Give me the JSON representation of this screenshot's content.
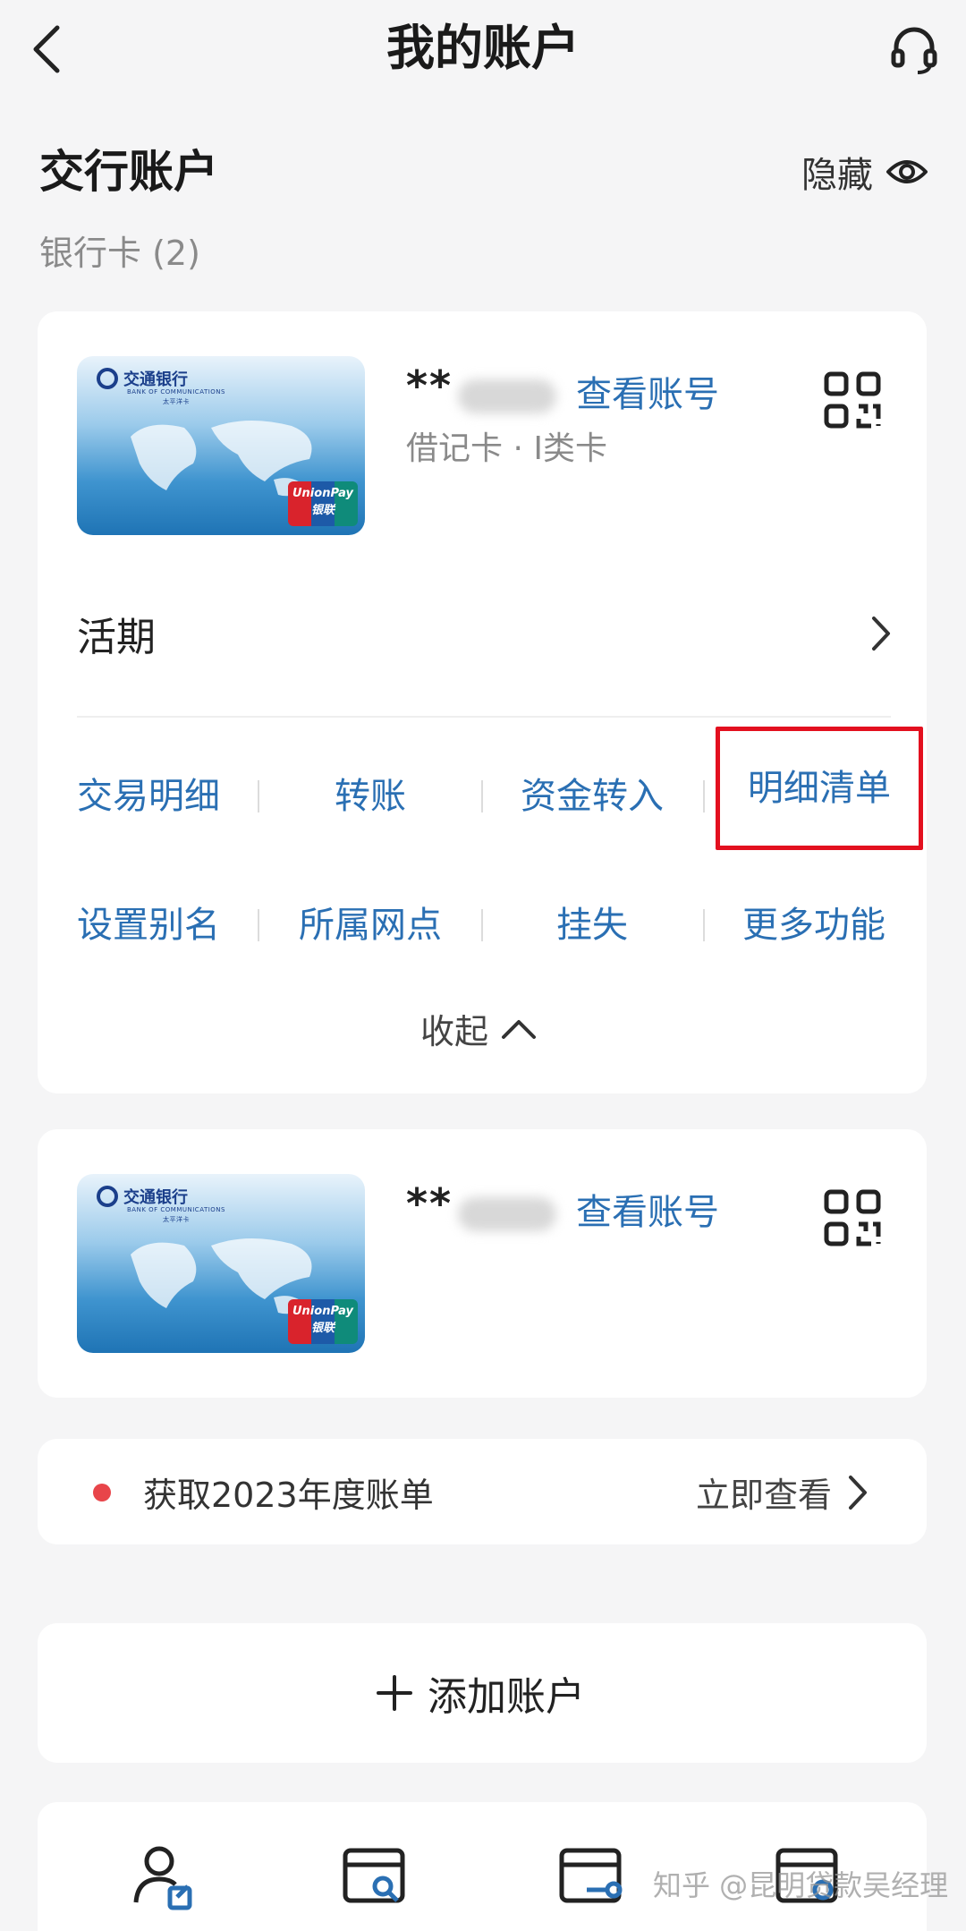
{
  "header": {
    "title": "我的账户"
  },
  "section": {
    "title": "交行账户",
    "hide_label": "隐藏",
    "subtitle": "银行卡 (2)"
  },
  "card1": {
    "bank_name": "交通银行",
    "bank_name_en": "BANK OF COMMUNICATIONS",
    "bank_region": "太平洋卡",
    "card_network": "UnionPay 银联",
    "masked_number": "**",
    "view_account": "查看账号",
    "card_type": "借记卡 · I类卡",
    "row_label": "活期",
    "functions": [
      "交易明细",
      "转账",
      "资金转入",
      "明细清单",
      "设置别名",
      "所属网点",
      "挂失",
      "更多功能"
    ],
    "collapse_label": "收起"
  },
  "card2": {
    "bank_name": "交通银行",
    "bank_name_en": "BANK OF COMMUNICATIONS",
    "bank_region": "太平洋卡",
    "card_network": "UnionPay 银联",
    "masked_number": "**",
    "view_account": "查看账号"
  },
  "bill": {
    "text": "获取2023年度账单",
    "link": "立即查看"
  },
  "add": {
    "label": "添加账户"
  },
  "watermark": "知乎 @昆明贷款吴经理",
  "colors": {
    "accent_blue": "#2a6fb3",
    "highlight_red": "#e3101f",
    "dot_red": "#e8454a"
  }
}
